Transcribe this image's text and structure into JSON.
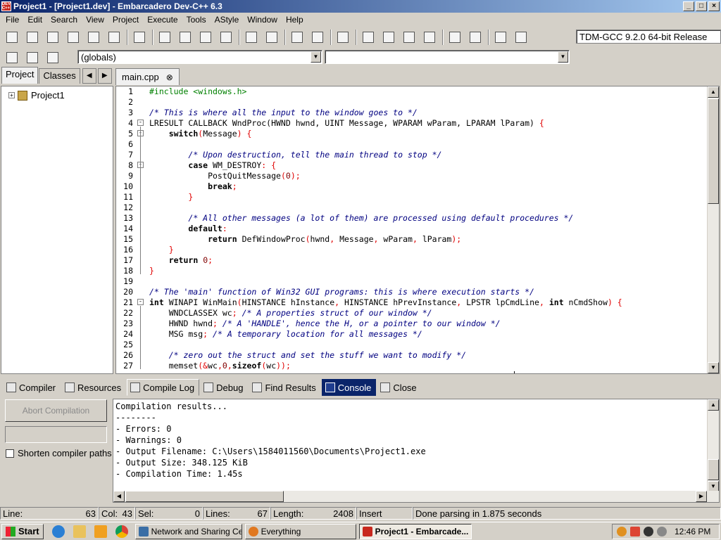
{
  "window": {
    "title": "Project1 - [Project1.dev] - Embarcadero Dev-C++ 6.3",
    "app_icon_text": "DEV C++",
    "minimize": "_",
    "maximize": "□",
    "close": "×"
  },
  "menu": [
    "File",
    "Edit",
    "Search",
    "View",
    "Project",
    "Execute",
    "Tools",
    "AStyle",
    "Window",
    "Help"
  ],
  "toolbar": {
    "compiler_select": "TDM-GCC 9.2.0 64-bit Release",
    "globals_select": "(globals)",
    "members_select": ""
  },
  "left_panel": {
    "tabs": [
      "Project",
      "Classes"
    ],
    "active_tab": "Project",
    "prev_arrow": "◀",
    "next_arrow": "▶",
    "tree_root": "Project1",
    "expand_glyph": "+"
  },
  "editor": {
    "tab_label": "main.cpp",
    "tab_close": "⊗",
    "lines": [
      {
        "n": "1",
        "fold": "",
        "html": "<span class=\"pp\">#include &lt;windows.h&gt;</span>"
      },
      {
        "n": "2",
        "fold": "",
        "html": ""
      },
      {
        "n": "3",
        "fold": "",
        "html": "<span class=\"cm\">/* This is where all the input to the window goes to */</span>"
      },
      {
        "n": "4",
        "fold": "-",
        "html": "LRESULT CALLBACK WndProc(HWND hwnd, UINT Message, WPARAM wParam, LPARAM lParam) <span class=\"sym\">{</span>"
      },
      {
        "n": "5",
        "fold": "-",
        "html": "    <span class=\"kw\">switch</span><span class=\"sym\">(</span>Message<span class=\"sym\">) {</span>"
      },
      {
        "n": "6",
        "fold": "",
        "html": ""
      },
      {
        "n": "7",
        "fold": "",
        "html": "        <span class=\"cm\">/* Upon destruction, tell the main thread to stop */</span>"
      },
      {
        "n": "8",
        "fold": "-",
        "html": "        <span class=\"kw\">case</span> WM_DESTROY<span class=\"sym\">: {</span>"
      },
      {
        "n": "9",
        "fold": "",
        "html": "            PostQuitMessage<span class=\"sym\">(</span><span class=\"num\">0</span><span class=\"sym\">);</span>"
      },
      {
        "n": "10",
        "fold": "",
        "html": "            <span class=\"kw\">break</span><span class=\"sym\">;</span>"
      },
      {
        "n": "11",
        "fold": "",
        "html": "        <span class=\"sym\">}</span>"
      },
      {
        "n": "12",
        "fold": "",
        "html": ""
      },
      {
        "n": "13",
        "fold": "",
        "html": "        <span class=\"cm\">/* All other messages (a lot of them) are processed using default procedures */</span>"
      },
      {
        "n": "14",
        "fold": "",
        "html": "        <span class=\"kw\">default</span><span class=\"sym\">:</span>"
      },
      {
        "n": "15",
        "fold": "",
        "html": "            <span class=\"kw\">return</span> DefWindowProc<span class=\"sym\">(</span>hwnd<span class=\"sym\">,</span> Message<span class=\"sym\">,</span> wParam<span class=\"sym\">,</span> lParam<span class=\"sym\">);</span>"
      },
      {
        "n": "16",
        "fold": "",
        "html": "    <span class=\"sym\">}</span>"
      },
      {
        "n": "17",
        "fold": "",
        "html": "    <span class=\"kw\">return</span> <span class=\"num\">0</span><span class=\"sym\">;</span>"
      },
      {
        "n": "18",
        "fold": "",
        "html": "<span class=\"sym\">}</span>"
      },
      {
        "n": "19",
        "fold": "",
        "html": ""
      },
      {
        "n": "20",
        "fold": "",
        "html": "<span class=\"cm\">/* The 'main' function of Win32 GUI programs: this is where execution starts */</span>"
      },
      {
        "n": "21",
        "fold": "-",
        "html": "<span class=\"kw\">int</span> WINAPI WinMain<span class=\"sym\">(</span>HINSTANCE hInstance<span class=\"sym\">,</span> HINSTANCE hPrevInstance<span class=\"sym\">,</span> LPSTR lpCmdLine<span class=\"sym\">,</span> <span class=\"kw\">int</span> nCmdShow<span class=\"sym\">) {</span>"
      },
      {
        "n": "22",
        "fold": "",
        "html": "    WNDCLASSEX wc<span class=\"sym\">;</span> <span class=\"cm\">/* A properties struct of our window */</span>"
      },
      {
        "n": "23",
        "fold": "",
        "html": "    HWND hwnd<span class=\"sym\">;</span> <span class=\"cm\">/* A 'HANDLE', hence the H, or a pointer to our window */</span>"
      },
      {
        "n": "24",
        "fold": "",
        "html": "    MSG msg<span class=\"sym\">;</span> <span class=\"cm\">/* A temporary location for all messages */</span>"
      },
      {
        "n": "25",
        "fold": "",
        "html": ""
      },
      {
        "n": "26",
        "fold": "",
        "html": "    <span class=\"cm\">/* zero out the struct and set the stuff we want to modify */</span>"
      },
      {
        "n": "27",
        "fold": "",
        "html": "    memset<span class=\"sym\">(&amp;</span>wc<span class=\"sym\">,</span><span class=\"num\">0</span><span class=\"sym\">,</span><span class=\"kw\">sizeof</span><span class=\"sym\">(</span>wc<span class=\"sym\">));</span>"
      }
    ]
  },
  "bottom_tabs": [
    {
      "label": "Compiler",
      "name": "tab-compiler"
    },
    {
      "label": "Resources",
      "name": "tab-resources"
    },
    {
      "label": "Compile Log",
      "name": "tab-compile-log"
    },
    {
      "label": "Debug",
      "name": "tab-debug"
    },
    {
      "label": "Find Results",
      "name": "tab-find-results"
    },
    {
      "label": "Console",
      "name": "tab-console"
    },
    {
      "label": "Close",
      "name": "tab-close"
    }
  ],
  "compile_log": {
    "abort_label": "Abort Compilation",
    "shorten_label": "Shorten compiler paths",
    "lines": [
      "Compilation results...",
      "--------",
      "- Errors: 0",
      "- Warnings: 0",
      "- Output Filename: C:\\Users\\1584011560\\Documents\\Project1.exe",
      "- Output Size: 348.125 KiB",
      "- Compilation Time: 1.45s"
    ]
  },
  "status": {
    "line_label": "Line:",
    "line_value": "63",
    "col_label": "Col:",
    "col_value": "43",
    "sel_label": "Sel:",
    "sel_value": "0",
    "lines_label": "Lines:",
    "lines_value": "67",
    "length_label": "Length:",
    "length_value": "2408",
    "mode": "Insert",
    "message": "Done parsing in 1.875 seconds"
  },
  "taskbar": {
    "start": "Start",
    "tasks": [
      "Network and Sharing Ce...",
      "Everything",
      "Project1 - Embarcade..."
    ],
    "clock": "12:46 PM"
  }
}
